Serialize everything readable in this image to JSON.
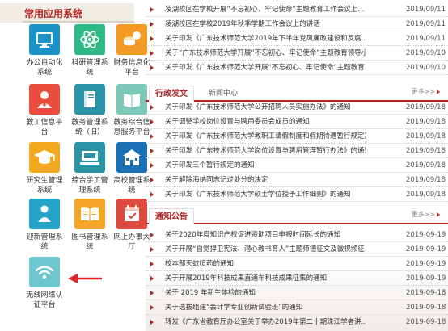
{
  "panel": {
    "title": "常用应用系统"
  },
  "apps": [
    {
      "label": "办公自动化\n系统",
      "icon": "monitor-icon",
      "color": "blue"
    },
    {
      "label": "科研管理系\n统",
      "icon": "atom-icon",
      "color": "green"
    },
    {
      "label": "财务信息化\n平台",
      "icon": "coins-icon",
      "color": "orange"
    },
    {
      "label": "教工信息平\n台",
      "icon": "teacher-icon",
      "color": "red"
    },
    {
      "label": "教务管理系\n统（旧）",
      "icon": "book-icon",
      "color": "teal"
    },
    {
      "label": "教务综合信\n息服务平台",
      "icon": "book-open-icon",
      "color": "lightgreen"
    },
    {
      "label": "研究生管理\n系统",
      "icon": "graduation-cap-icon",
      "color": "gold"
    },
    {
      "label": "综合学工管\n理系统",
      "icon": "desk-icon",
      "color": "teal"
    },
    {
      "label": "高校管理系\n统",
      "icon": "building-icon",
      "color": "navy"
    },
    {
      "label": "迎新管理系\n统",
      "icon": "person-icon",
      "color": "cyan"
    },
    {
      "label": "图书管理系\n统",
      "icon": "open-book-icon",
      "color": "amber"
    },
    {
      "label": "网上办事大\n厅",
      "icon": "calendar-icon",
      "color": "crimson"
    },
    {
      "label": "无线网络认\n证平台",
      "icon": "wifi-icon",
      "color": "wifi"
    }
  ],
  "top_news": [
    {
      "title": "凌湖校区在学校开展“不忘初心、牢记使命”主题教育工作会议上...",
      "date": "2019/09/11"
    },
    {
      "title": "凌湖校区在学校2019年秋季学期工作会议上的讲话",
      "date": "2019/09/11"
    },
    {
      "title": "关于印发《广东技术师范大学2019年下半年党风廉政建设和反腐...",
      "date": "2019/09/11"
    },
    {
      "title": "关于“广东技术师范大学开展“不忘初心、牢记使命”主题教育领导小组办...",
      "date": "2019/09/10"
    },
    {
      "title": "关于印发《广东技术师范大学开展“不忘初心、牢记使命”主题教育...",
      "date": "2019/09/10"
    }
  ],
  "section1": {
    "active_tab": "行政发文",
    "tab2": "新闻中心",
    "more": "更多>>",
    "items": [
      {
        "title": "关于印发《广东技术师范大学公开招聘人员实施办法》的通知",
        "date": "2019/09/18"
      },
      {
        "title": "关于调整学校岗位设置与聘用委员会成员的通知",
        "date": "2019/09/18"
      },
      {
        "title": "关于印发《广东技术师范大学教职工请假制度和假期待遇暂行规定》...",
        "date": "2019/09/18"
      },
      {
        "title": "关于印发《广东技术师范大学岗位设置与聘用管理暂行办法》的通知",
        "date": "2019/09/18"
      },
      {
        "title": "关于印发三个暂行规定的通知",
        "date": "2019/09/18"
      },
      {
        "title": "关于解除海纳同志记过处分的决定",
        "date": "2019/09/18"
      },
      {
        "title": "关于印发《广东技术师范大学硕士学位授予工作细则》的通知",
        "date": "2019/09/18"
      }
    ]
  },
  "section2": {
    "active_tab": "通知公告",
    "more": "更多>>",
    "items": [
      {
        "title": "关于2020年度知识产权促进资助项目申报时间延长的通知",
        "date": "2019-09-19"
      },
      {
        "title": "关于开展“自觉捍卫宪法、潜心教书育人”主题师德征文及微视频征...",
        "date": "2019-09-19"
      },
      {
        "title": "校本部灭蚊喷药的通知",
        "date": "2019-09-19"
      },
      {
        "title": "关于开展2019年科技成果直通车科技成果征集的通知",
        "date": "2019-09-19"
      },
      {
        "title": "关于 2019 年新生体检的通知",
        "date": "2019-09-18"
      },
      {
        "title": "关于选拔组建“会计学专业创新试验班”的通知",
        "date": "2019-09-18"
      },
      {
        "title": "转发《广东省教育厅办公室关于举办2019年第二十期珠江学者讲...",
        "date": "2019-09-18"
      }
    ]
  },
  "colors": {
    "brand_red": "#b22222",
    "panel_bg": "#f0ece4"
  }
}
